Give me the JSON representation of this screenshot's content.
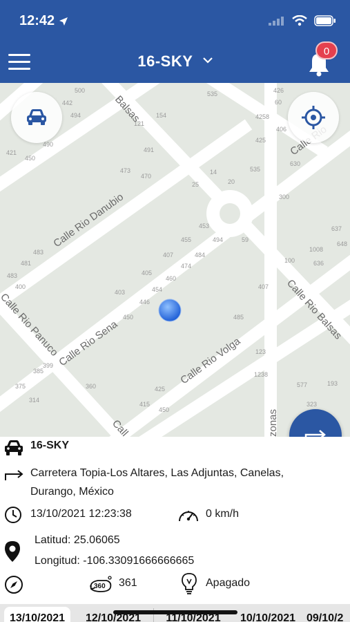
{
  "status_bar": {
    "time": "12:42",
    "icons": [
      "signal-icon",
      "wifi-icon",
      "battery-icon"
    ]
  },
  "app_bar": {
    "title": "16-SKY",
    "notification_count": "0",
    "colors": {
      "primary": "#2b57a3",
      "badge": "#e5404e"
    }
  },
  "map": {
    "labels": {
      "streets": [
        "Balsas",
        "Calle Rio Danubio",
        "Calle Rio Sena",
        "Calle Rio Volga",
        "Calle Rio Panuco",
        "Calle Rio Balsas",
        "Calle Rio",
        "zonas",
        "Call"
      ],
      "numbers": [
        "500",
        "442",
        "494",
        "490",
        "421",
        "450",
        "535",
        "121",
        "154",
        "491",
        "473",
        "470",
        "25",
        "20",
        "14",
        "535",
        "426",
        "60",
        "4258",
        "406",
        "425",
        "630",
        "300",
        "453",
        "455",
        "494",
        "59",
        "407",
        "474",
        "484",
        "460",
        "405",
        "454",
        "446",
        "403",
        "450",
        "485",
        "407",
        "100",
        "1008",
        "636",
        "637",
        "648",
        "483",
        "481",
        "483",
        "400",
        "399",
        "385",
        "375",
        "360",
        "314",
        "425",
        "415",
        "450",
        "123",
        "1238",
        "577",
        "193",
        "323"
      ]
    }
  },
  "info": {
    "vehicle_name": "16-SKY",
    "address_line1": "Carretera Topia-Los Altares, Las Adjuntas, Canelas,",
    "address_line2": "Durango, México",
    "datetime": "13/10/2021 12:23:38",
    "speed": "0 km/h",
    "latitude": "Latitud: 25.06065",
    "longitude": "Longitud: -106.33091666666665",
    "heading": "361",
    "ignition": "Apagado"
  },
  "tabs": [
    "13/10/2021",
    "12/10/2021",
    "11/10/2021",
    "10/10/2021",
    "09/10/2"
  ]
}
